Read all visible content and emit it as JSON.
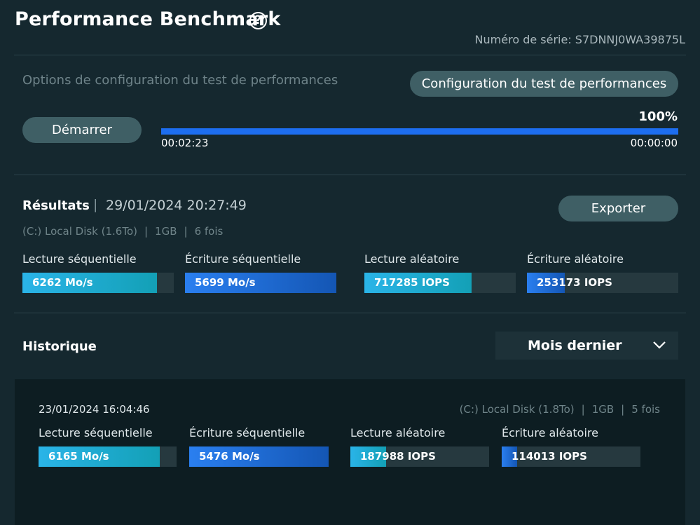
{
  "header": {
    "title": "Performance Benchmark",
    "help_glyph": "?",
    "serial": "Numéro de série: S7DNNJ0WA39875L"
  },
  "config": {
    "options_label": "Options de configuration du test de performances",
    "config_button": "Configuration du test de performances",
    "start_button": "Démarrer"
  },
  "progress": {
    "percent_label": "100%",
    "percent": 100,
    "elapsed": "00:02:23",
    "remaining": "00:00:00"
  },
  "results": {
    "label": "Résultats",
    "separator": "|",
    "date": "29/01/2024 20:27:49",
    "disk": "(C:) Local Disk (1.6To)",
    "size": "1GB",
    "runs": "6 fois",
    "export_button": "Exporter",
    "metrics": [
      {
        "label": "Lecture séquentielle",
        "value": "6262 Mo/s",
        "fill_fraction": 0.89
      },
      {
        "label": "Écriture séquentielle",
        "value": "5699 Mo/s",
        "fill_fraction": 1.0
      },
      {
        "label": "Lecture aléatoire",
        "value": "717285 IOPS",
        "fill_fraction": 0.71
      },
      {
        "label": "Écriture aléatoire",
        "value": "253173 IOPS",
        "fill_fraction": 0.25
      }
    ]
  },
  "history": {
    "label": "Historique",
    "period": "Mois dernier",
    "entries": [
      {
        "date": "23/01/2024 16:04:46",
        "disk": "(C:) Local Disk (1.8To)",
        "size": "1GB",
        "runs": "5 fois",
        "metrics": [
          {
            "label": "Lecture séquentielle",
            "value": "6165 Mo/s",
            "fill_fraction": 0.88
          },
          {
            "label": "Écriture séquentielle",
            "value": "5476 Mo/s",
            "fill_fraction": 1.0
          },
          {
            "label": "Lecture aléatoire",
            "value": "187988 IOPS",
            "fill_fraction": 0.26
          },
          {
            "label": "Écriture aléatoire",
            "value": "114013 IOPS",
            "fill_fraction": 0.11
          }
        ]
      }
    ]
  },
  "colors": {
    "background": "#15282f",
    "accent_blue": "#1d6ef0",
    "cyan_fill": "#2ab4e8",
    "button": "#3f5f65"
  }
}
